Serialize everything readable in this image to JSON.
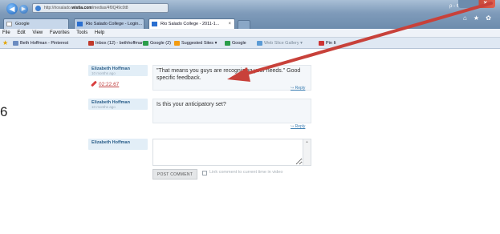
{
  "browser": {
    "address": {
      "prefix": "http://riosalado.",
      "domain": "wistia.com",
      "path": "/medias/4f0Q49c0t8"
    },
    "tabs": [
      {
        "label": "Google"
      },
      {
        "label": "Rio Salado College - Login..."
      },
      {
        "label": "Rio Salado College - 2011-1...",
        "close": "×"
      }
    ],
    "search_control": "ρ ‑ ¢ ×",
    "close_glyph": "×",
    "home_icons": "⌂ ★ ✿"
  },
  "menu": [
    "File",
    "Edit",
    "View",
    "Favorites",
    "Tools",
    "Help"
  ],
  "favorites": [
    {
      "label": "Beth Hoffman - Pinterest"
    },
    {
      "label": "Inbox (12) - bethhoffman..."
    },
    {
      "label": "Google (2)"
    },
    {
      "label": "Suggested Sites ▾"
    },
    {
      "label": "Google"
    },
    {
      "label": "Web Slice Gallery ▾"
    },
    {
      "label": "Pin It"
    }
  ],
  "comments": [
    {
      "author": "Elizabeth Hoffman",
      "time": "10 months ago",
      "timestamp": "02:22.67",
      "text": "\"That means you guys are recognizing your needs.\" Good specific feedback.",
      "reply": "Reply"
    },
    {
      "author": "Elizabeth Hoffman",
      "time": "10 months ago",
      "text": "Is this your anticipatory set?",
      "reply": "Reply"
    }
  ],
  "new_comment": {
    "author": "Elizabeth Hoffman",
    "input_value": "",
    "post_label": "POST COMMENT",
    "link_label": "Link comment to current time in video",
    "scroll_glyphs": "▲"
  },
  "side_digit": "6",
  "colors": {
    "arrow": "#c8413a",
    "author_bg": "#e2eef7",
    "link": "#3d7fb3"
  }
}
